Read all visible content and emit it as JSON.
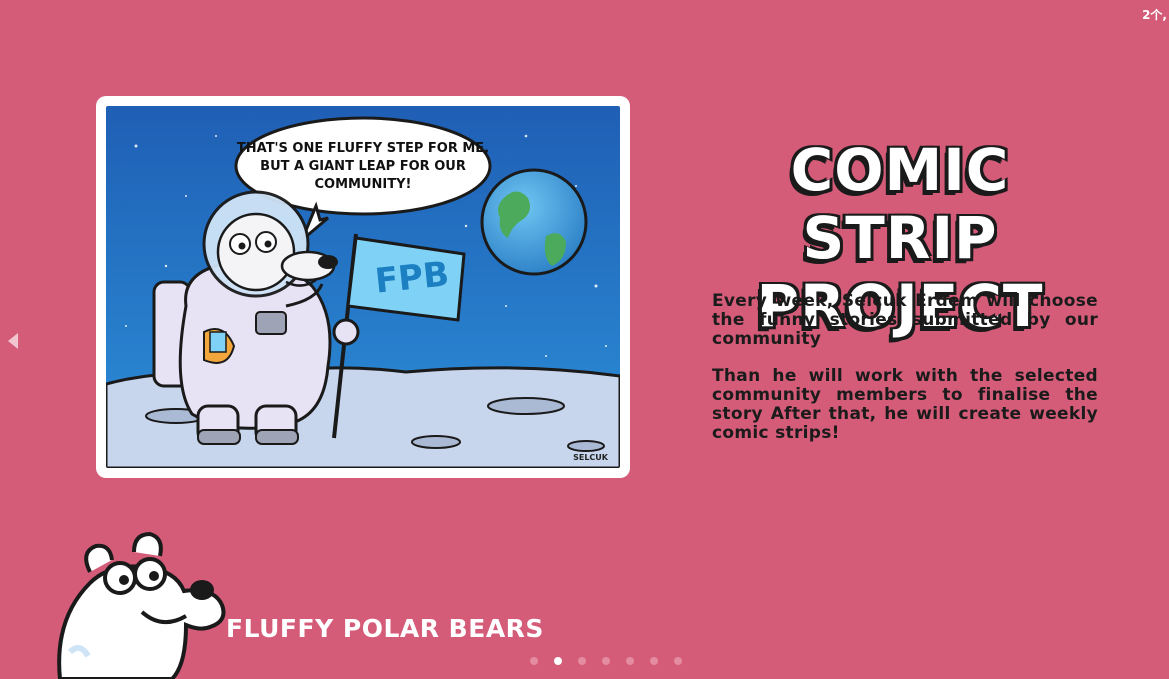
{
  "corner_badge": "2个,",
  "comic": {
    "speech_bubble": "THAT'S ONE FLUFFY STEP FOR ME, BUT A GIANT LEAP FOR OUR COMMUNITY!",
    "flag_text": "FPB",
    "signature": "SELCUK"
  },
  "headline": {
    "line1": "COMIC STRIP",
    "line2": "PROJECT"
  },
  "description": {
    "paragraph1": "Every week, Selcuk Erdem will choose the funny stories submitted by our community",
    "paragraph2": "Than he will work with the selected community members to finalise the story After that, he will create weekly comic strips!"
  },
  "brand": {
    "name": "FLUFFY POLAR BEARS"
  },
  "carousel": {
    "dots": [
      "slide-1",
      "slide-2",
      "slide-3",
      "slide-4",
      "slide-5",
      "slide-6",
      "slide-7"
    ],
    "active_index": 1
  },
  "icons": {
    "prev": "chevron-left-icon"
  },
  "colors": {
    "background": "#d45c79",
    "text_dark": "#1b1b1b",
    "dot_inactive": "#e58ca2",
    "dot_active": "#ffffff"
  }
}
